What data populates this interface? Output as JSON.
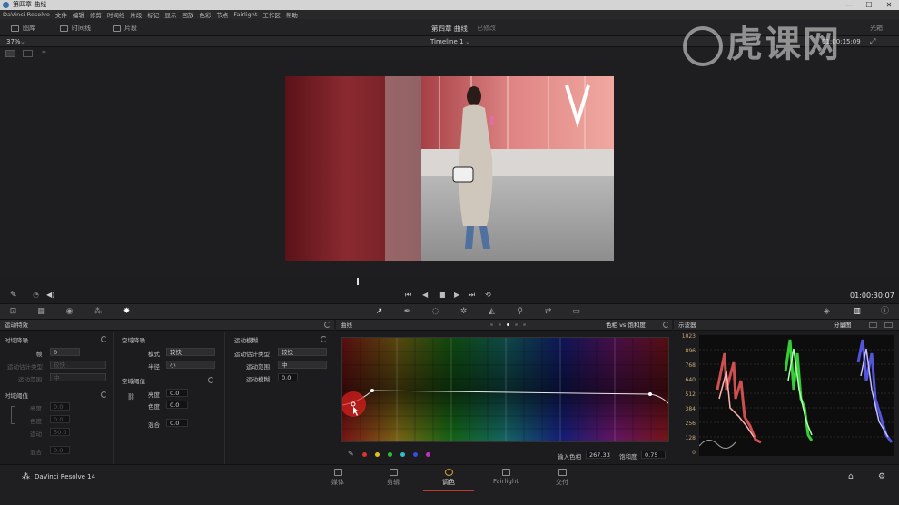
{
  "window": {
    "title": "第四章 曲线",
    "controls": [
      "—",
      "☐",
      "✕"
    ]
  },
  "menu": {
    "items": [
      "DaVinci Resolve",
      "文件",
      "编辑",
      "修剪",
      "时间线",
      "片段",
      "标记",
      "显示",
      "回放",
      "色彩",
      "节点",
      "Fairlight",
      "工作区",
      "帮助"
    ]
  },
  "toolbar": {
    "media_pool": "图库",
    "timeline": "时间线",
    "clips": "片段",
    "project_title": "第四章 曲线",
    "project_status": "已修改",
    "right_label": "光箱"
  },
  "viewer": {
    "zoom": "37%",
    "timeline_name": "Timeline 1",
    "timecode_top": "01:00:15:09",
    "timecode": "01:00:30:07"
  },
  "panels": {
    "motion_effects": {
      "title": "运动特效",
      "temporal_nr": {
        "title": "时域降噪",
        "frames_label": "帧",
        "frames_value": "0",
        "motion_type_label": "运动估计类型",
        "motion_type_value": "较快",
        "motion_range_label": "运动范围",
        "motion_range_value": "中"
      },
      "temporal_threshold": {
        "title": "时域阈值",
        "luma_label": "亮度",
        "luma_value": "0.0",
        "chroma_label": "色度",
        "chroma_value": "0.0",
        "motion_label": "运动",
        "motion_value": "50.0",
        "blend_label": "混合",
        "blend_value": "0.0"
      },
      "spatial_nr": {
        "title": "空域降噪",
        "mode_label": "模式",
        "mode_value": "较快",
        "radius_label": "半径",
        "radius_value": "小"
      },
      "spatial_threshold": {
        "title": "空域阈值",
        "luma_label": "亮度",
        "luma_value": "0.0",
        "chroma_label": "色度",
        "chroma_value": "0.0",
        "blend_label": "混合",
        "blend_value": "0.0"
      },
      "motion_blur": {
        "title": "运动模糊",
        "motion_type_label": "运动估计类型",
        "motion_type_value": "较快",
        "motion_range_label": "运动范围",
        "motion_range_value": "中",
        "blur_label": "运动模糊",
        "blur_value": "0.0"
      }
    },
    "curves": {
      "title": "曲线",
      "mode": "色相 vs 饱和度",
      "input_hue_label": "输入色相",
      "input_hue_value": "267.33",
      "saturation_label": "饱和度",
      "saturation_value": "0.75",
      "swatch_colors": [
        "#e03030",
        "#e0c020",
        "#30c030",
        "#30c0c0",
        "#3050e0",
        "#c030c0"
      ]
    },
    "scopes": {
      "title": "示波器",
      "mode": "分量图",
      "scale_labels": [
        "1023",
        "896",
        "768",
        "640",
        "512",
        "384",
        "256",
        "128",
        "0"
      ]
    }
  },
  "bottom": {
    "brand": "DaVinci Resolve 14",
    "pages": [
      {
        "label": "媒体",
        "active": false
      },
      {
        "label": "剪辑",
        "active": false
      },
      {
        "label": "调色",
        "active": true
      },
      {
        "label": "Fairlight",
        "active": false
      },
      {
        "label": "交付",
        "active": false
      }
    ]
  },
  "watermark": {
    "text": "虎课网"
  }
}
